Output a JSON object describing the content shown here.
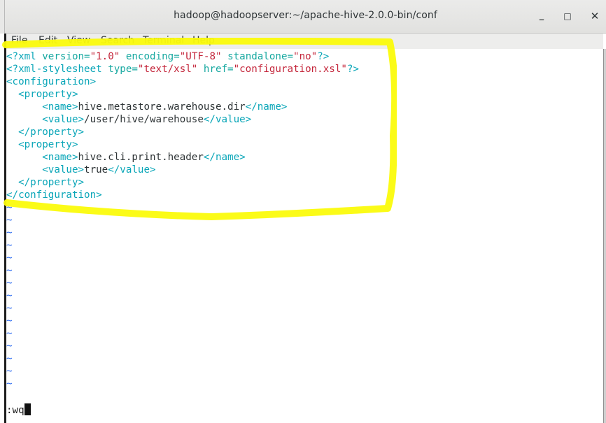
{
  "window": {
    "title": "hadoop@hadoopserver:~/apache-hive-2.0.0-bin/conf",
    "minimize_icon": "minimize-icon",
    "maximize_icon": "maximize-icon",
    "close_icon": "close-icon",
    "minimize_glyph": "_",
    "maximize_glyph": "□",
    "close_glyph": "✕"
  },
  "menu": {
    "file": "File",
    "edit": "Edit",
    "view": "View",
    "search": "Search",
    "terminal": "Terminal",
    "help": "Help"
  },
  "editor": {
    "xml_decl": {
      "open": "<?xml",
      "a1": " version=",
      "v1": "\"1.0\"",
      "a2": " encoding=",
      "v2": "\"UTF-8\"",
      "a3": " standalone=",
      "v3": "\"no\"",
      "close": "?>"
    },
    "stylesheet": {
      "open": "<?xml-stylesheet",
      "a1": " type=",
      "v1": "\"text/xsl\"",
      "a2": " href=",
      "v2": "\"configuration.xsl\"",
      "close": "?>"
    },
    "config_open": "<configuration>",
    "prop1_open": "  <property>",
    "prop1_name": {
      "indent": "      ",
      "open": "<name>",
      "text": "hive.metastore.warehouse.dir",
      "close": "</name>"
    },
    "prop1_value": {
      "indent": "      ",
      "open": "<value>",
      "text": "/user/hive/warehouse",
      "close": "</value>"
    },
    "prop1_close": "  </property>",
    "prop2_open": "  <property>",
    "prop2_name": {
      "indent": "      ",
      "open": "<name>",
      "text": "hive.cli.print.header",
      "close": "</name>"
    },
    "prop2_value": {
      "indent": "      ",
      "open": "<value>",
      "text": "true",
      "close": "</value>"
    },
    "prop2_close": "  </property>",
    "config_close": "</configuration>",
    "tilde": "~",
    "command": ":wq"
  },
  "colors": {
    "highlight": "#fbfb0c",
    "tag": "#0aa6b8",
    "string": "#c4263b",
    "tilde": "#2f6df0"
  }
}
